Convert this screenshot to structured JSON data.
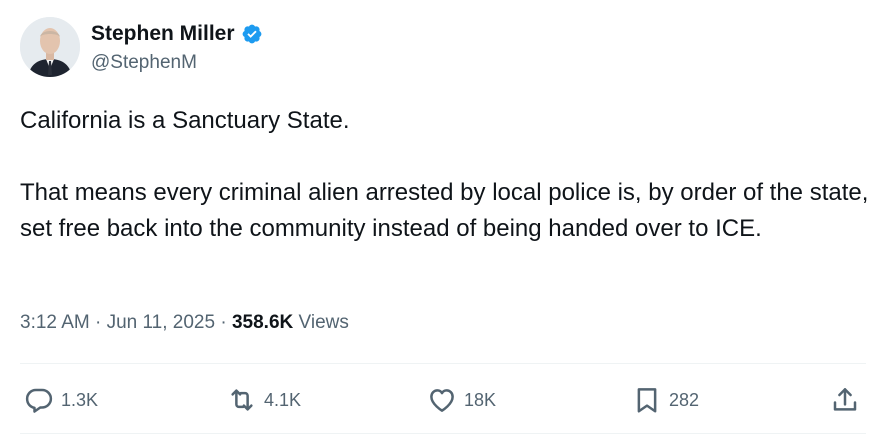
{
  "author": {
    "display_name": "Stephen Miller",
    "handle": "@StephenM",
    "verified": true,
    "verified_color": "#1d9bf0"
  },
  "tweet": {
    "paragraphs": [
      "California is a Sanctuary State.",
      "That means every criminal alien arrested by local police is, by order of the state, set free back into the community instead of being handed over to ICE."
    ]
  },
  "meta": {
    "time": "3:12 AM",
    "separator": "·",
    "date": "Jun 11, 2025",
    "views_count": "358.6K",
    "views_label": "Views"
  },
  "actions": {
    "reply": {
      "icon": "reply-icon",
      "count": "1.3K"
    },
    "retweet": {
      "icon": "retweet-icon",
      "count": "4.1K"
    },
    "like": {
      "icon": "heart-icon",
      "count": "18K"
    },
    "bookmark": {
      "icon": "bookmark-icon",
      "count": "282"
    },
    "share": {
      "icon": "share-icon"
    }
  },
  "colors": {
    "text_primary": "#0f1419",
    "text_secondary": "#536471",
    "divider": "#eff3f4",
    "accent": "#1d9bf0"
  }
}
